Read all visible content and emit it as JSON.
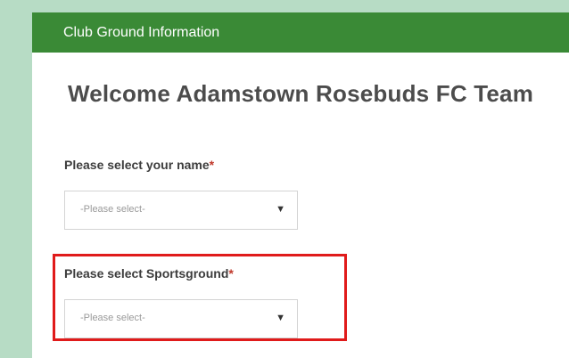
{
  "header": {
    "title": "Club Ground Information"
  },
  "welcome": {
    "text": "Welcome Adamstown Rosebuds FC Team"
  },
  "fields": [
    {
      "label": "Please select your name",
      "required_mark": "*",
      "placeholder": "-Please select-",
      "arrow": "▼"
    },
    {
      "label": "Please select Sportsground",
      "required_mark": "*",
      "placeholder": "-Please select-",
      "arrow": "▼"
    }
  ],
  "colors": {
    "header_bg": "#3a8a36",
    "side_strip": "#b7dcc5",
    "highlight": "#e01b1b",
    "required": "#c0392b"
  },
  "icons": {
    "dropdown": "chevron-down-icon"
  }
}
